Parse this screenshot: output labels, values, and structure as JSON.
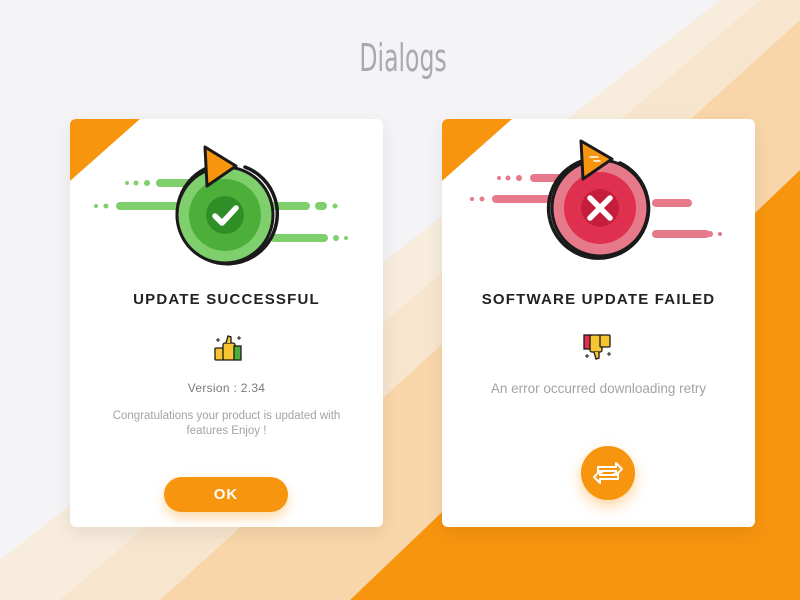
{
  "page": {
    "title": "Dialogs"
  },
  "colors": {
    "accent": "#f7950f",
    "success": "#4caf3a",
    "success_light": "#7fcf6c",
    "error": "#e0304f",
    "error_light": "#e77a8a",
    "background": "#f4f4f6"
  },
  "success_dialog": {
    "title": "UPDATE SUCCESSFUL",
    "version": "Version : 2.34",
    "message": "Congratulations your product is updated with features Enjoy !",
    "ok_label": "OK",
    "status_icon": "check-icon",
    "emoji_icon": "thumbs-up-icon"
  },
  "failed_dialog": {
    "title": "SOFTWARE UPDATE FAILED",
    "message": "An error occurred downloading retry",
    "status_icon": "close-icon",
    "emoji_icon": "thumbs-down-icon",
    "retry_icon": "retry-arrows-icon"
  }
}
